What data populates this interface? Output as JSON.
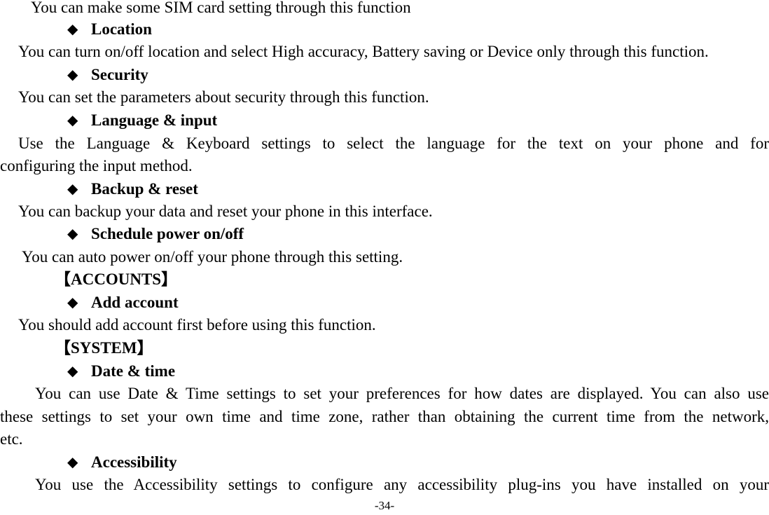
{
  "page": {
    "lines": {
      "sim_desc": "You can make some SIM card setting through this function",
      "location_heading": "Location",
      "location_desc": "You can turn on/off location and select High accuracy, Battery saving or Device only through this function.",
      "security_heading": "Security",
      "security_desc": "You can set the parameters about security through this function.",
      "language_heading": "Language & input",
      "language_desc_1": "Use the Language & Keyboard settings to select the language for the text on your phone and for",
      "language_desc_2": "configuring the input method.",
      "backup_heading": "Backup & reset",
      "backup_desc": "You can backup your data and reset your phone in this interface.",
      "schedule_heading": "Schedule power on/off",
      "schedule_desc": "You can auto power on/off your phone through this setting.",
      "accounts_section": "【ACCOUNTS】",
      "add_account_heading": "Add account",
      "add_account_desc": "You should add account first before using this function.",
      "system_section": "【SYSTEM】",
      "datetime_heading": "Date & time",
      "datetime_desc_1": "You can use Date & Time settings to set your preferences for how dates are displayed. You can also use",
      "datetime_desc_2": "these settings to set your own time and time zone, rather than obtaining the current time from the network,",
      "datetime_desc_3": "etc.",
      "accessibility_heading": "Accessibility",
      "accessibility_desc_1": "You use the Accessibility settings to configure any accessibility plug-ins you have installed on your"
    },
    "bullet_glyph": "◆",
    "page_number": "-34-"
  }
}
